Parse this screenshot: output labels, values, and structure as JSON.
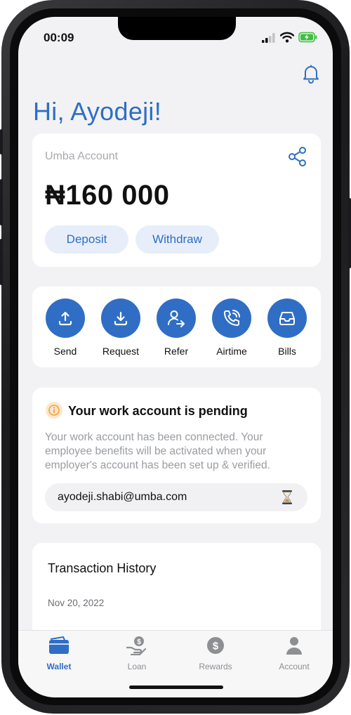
{
  "status_bar": {
    "time": "00:09"
  },
  "header": {
    "greeting": "Hi, Ayodeji!"
  },
  "account": {
    "label": "Umba Account",
    "balance": "₦160 000",
    "deposit_label": "Deposit",
    "withdraw_label": "Withdraw"
  },
  "actions": [
    {
      "label": "Send",
      "icon": "upload-icon"
    },
    {
      "label": "Request",
      "icon": "download-icon"
    },
    {
      "label": "Refer",
      "icon": "refer-user-icon"
    },
    {
      "label": "Airtime",
      "icon": "phone-call-icon"
    },
    {
      "label": "Bills",
      "icon": "inbox-tray-icon"
    }
  ],
  "pending": {
    "title": "Your work account is pending",
    "lines": [
      "Your work account has been connected. Your",
      "employee benefits will be activated when your",
      "employer's account has been set up & verified."
    ],
    "email": "ayodeji.shabi@umba.com"
  },
  "transactions": {
    "title": "Transaction History",
    "date": "Nov 20, 2022"
  },
  "tabbar": {
    "tabs": [
      {
        "label": "Wallet",
        "icon": "wallet-icon",
        "active": true
      },
      {
        "label": "Loan",
        "icon": "loan-hand-icon",
        "active": false
      },
      {
        "label": "Rewards",
        "icon": "dollar-coin-icon",
        "active": false
      },
      {
        "label": "Account",
        "icon": "user-icon",
        "active": false
      }
    ]
  },
  "colors": {
    "accent": "#2f6ec4",
    "accent_light": "#e7eefa",
    "background": "#f2f2f4",
    "warning": "#f0a23b",
    "inactive_tab": "#8e8f93"
  }
}
